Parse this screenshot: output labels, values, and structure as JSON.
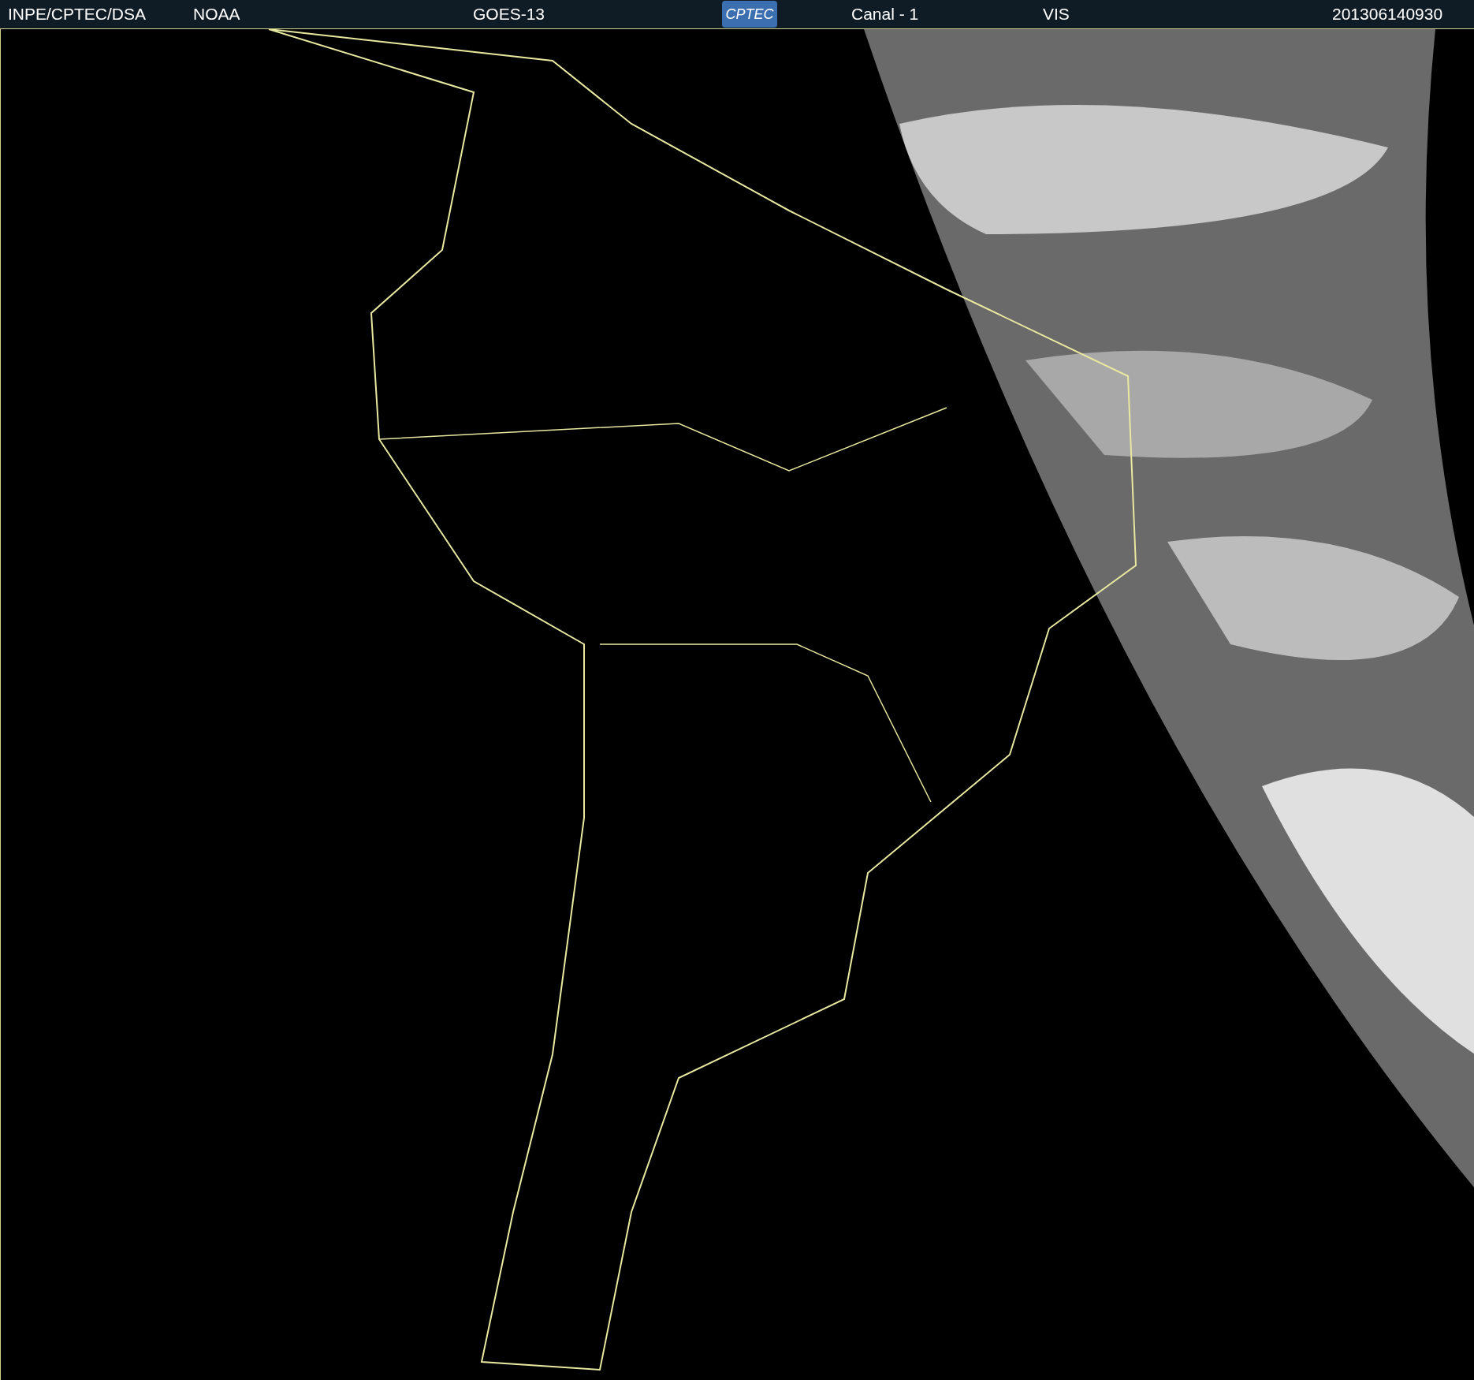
{
  "header": {
    "items": [
      {
        "kind": "text",
        "text": "INPE/CPTEC/DSA"
      },
      {
        "kind": "text",
        "text": "NOAA"
      },
      {
        "kind": "text",
        "text": "GOES-13"
      },
      {
        "kind": "logo",
        "text": "CPTEC"
      },
      {
        "kind": "text",
        "text": "Canal - 1"
      },
      {
        "kind": "text",
        "text": "VIS"
      },
      {
        "kind": "text",
        "text": "201306140930"
      }
    ]
  }
}
